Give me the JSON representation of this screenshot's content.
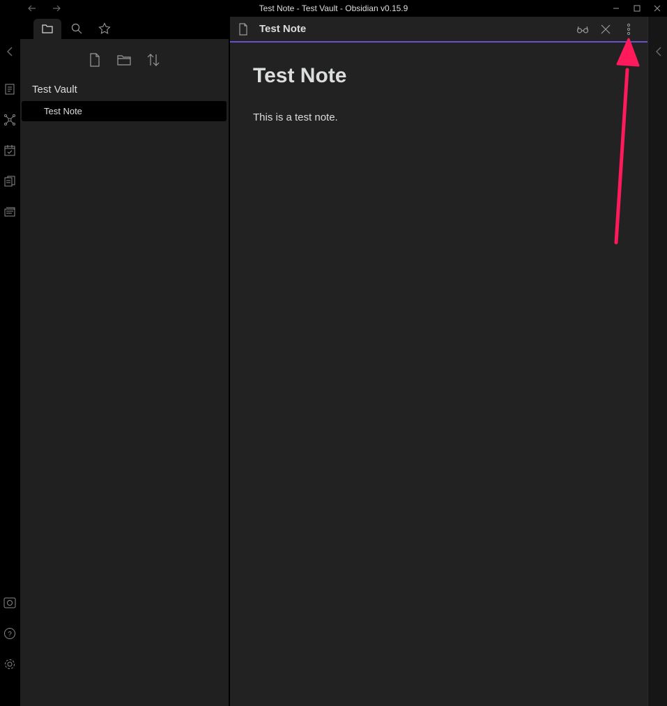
{
  "window": {
    "title": "Test Note - Test Vault - Obsidian v0.15.9",
    "back_icon": "arrow-left-icon",
    "forward_icon": "arrow-right-icon"
  },
  "ribbon": {
    "top_icons": [
      "switcher-icon",
      "graph-view-icon",
      "daily-note-icon",
      "templates-icon",
      "slides-icon"
    ],
    "bottom_icons": [
      "vault-switcher-icon",
      "help-icon",
      "settings-icon"
    ]
  },
  "sidebar": {
    "tabs": [
      "file-explorer-icon",
      "search-icon",
      "star-icon"
    ],
    "actions": [
      "new-note-icon",
      "new-folder-icon",
      "sort-icon"
    ],
    "vault_name": "Test Vault",
    "files": [
      {
        "label": "Test Note",
        "active": true
      }
    ]
  },
  "editor": {
    "header_title": "Test Note",
    "header_actions": [
      "reading-view-icon",
      "close-icon",
      "more-options-icon"
    ],
    "heading": "Test Note",
    "paragraph": "This is a test note."
  },
  "colors": {
    "accent": "#6c4fcf",
    "annotation_arrow": "#ff1a5c",
    "background": "#202020",
    "text": "#dcddde"
  }
}
